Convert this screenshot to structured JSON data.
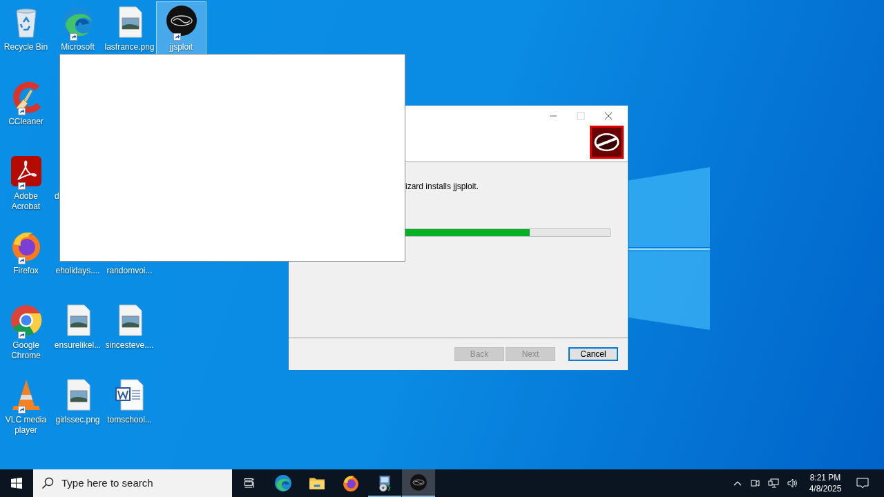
{
  "desktop_icons": [
    {
      "label": "Recycle Bin",
      "kind": "recycle",
      "shortcut": false,
      "selected": false
    },
    {
      "label": "Microsoft",
      "kind": "edge",
      "shortcut": true,
      "selected": false
    },
    {
      "label": "lasfrance.png",
      "kind": "image",
      "shortcut": false,
      "selected": false
    },
    {
      "label": "jjsploit",
      "kind": "jjsploit",
      "shortcut": true,
      "selected": true
    },
    {
      "label": "CCleaner",
      "kind": "ccleaner",
      "shortcut": true,
      "selected": false
    },
    {
      "label": "Adobe Acrobat",
      "kind": "acrobat",
      "shortcut": true,
      "selected": false
    },
    {
      "label": "d",
      "kind": "partial",
      "selected": false
    },
    {
      "label": "Firefox",
      "kind": "firefox",
      "shortcut": true,
      "selected": false
    },
    {
      "label": "eholidays....",
      "kind": "covered",
      "selected": false
    },
    {
      "label": "randomvoi...",
      "kind": "covered",
      "selected": false
    },
    {
      "label": "Google Chrome",
      "kind": "chrome",
      "shortcut": true,
      "selected": false
    },
    {
      "label": "ensurelikel...",
      "kind": "image",
      "shortcut": false,
      "selected": false
    },
    {
      "label": "sincesteve....",
      "kind": "image",
      "shortcut": false,
      "selected": false
    },
    {
      "label": "VLC media player",
      "kind": "vlc",
      "shortcut": true,
      "selected": false
    },
    {
      "label": "girlssec.png",
      "kind": "image",
      "shortcut": false,
      "selected": false
    },
    {
      "label": "tomschool...",
      "kind": "word",
      "shortcut": false,
      "selected": false
    }
  ],
  "installer": {
    "body_text": "izard installs jjsploit.",
    "progress": {
      "level": 0.74
    },
    "buttons": [
      {
        "label": "Back",
        "disabled": true,
        "focused": false
      },
      {
        "label": "Next",
        "disabled": true,
        "focused": false
      },
      {
        "label": "Cancel",
        "disabled": false,
        "focused": true
      }
    ]
  },
  "taskbar": {
    "search_placeholder": "Type here to search",
    "apps": [
      {
        "kind": "taskview",
        "running": false,
        "active": false
      },
      {
        "kind": "edge",
        "running": false,
        "active": false
      },
      {
        "kind": "explorer",
        "running": false,
        "active": false
      },
      {
        "kind": "firefox",
        "running": false,
        "active": false
      },
      {
        "kind": "installer",
        "running": true,
        "active": false
      },
      {
        "kind": "jjsploit",
        "running": true,
        "active": true
      }
    ],
    "time": "8:21 PM",
    "date": "4/8/2025"
  }
}
